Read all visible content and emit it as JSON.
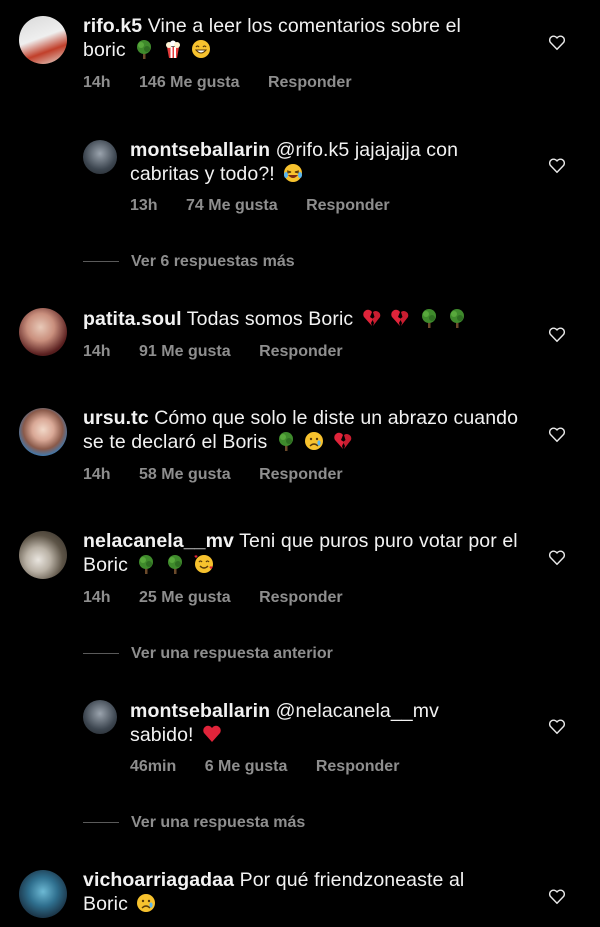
{
  "comments": [
    {
      "user": "rifo.k5",
      "text": " Vine a leer los comentarios sobre el boric",
      "time": "14h",
      "likes": "146 Me gusta",
      "reply": "Responder"
    },
    {
      "user": "montseballarin",
      "text": " @rifo.k5 jajajajja con cabritas y todo?!",
      "time": "13h",
      "likes": "74 Me gusta",
      "reply": "Responder"
    },
    {
      "user": "patita.soul",
      "text": " Todas somos Boric",
      "time": "14h",
      "likes": "91 Me gusta",
      "reply": "Responder"
    },
    {
      "user": "ursu.tc",
      "text": " Cómo que solo le diste un abrazo cuando se te declaró el Boris",
      "time": "14h",
      "likes": "58 Me gusta",
      "reply": "Responder"
    },
    {
      "user": "nelacanela__mv",
      "text": " Teni que puros puro votar por el Boric",
      "time": "14h",
      "likes": "25 Me gusta",
      "reply": "Responder"
    },
    {
      "user": "montseballarin",
      "text": " @nelacanela__mv sabido!",
      "time": "46min",
      "likes": "6 Me gusta",
      "reply": "Responder"
    },
    {
      "user": "vichoarriagadaa",
      "text": " Por qué friendzoneaste al Boric",
      "time": "",
      "likes": "",
      "reply": ""
    }
  ],
  "view_more": [
    "Ver 6 respuestas más",
    "Ver una respuesta anterior",
    "Ver una respuesta más"
  ],
  "colors": {
    "background": "#000000",
    "text": "#f2f2f2",
    "muted": "#8e8e8e",
    "heart_red": "#e0243a",
    "tree_green": "#3a7d2a"
  }
}
